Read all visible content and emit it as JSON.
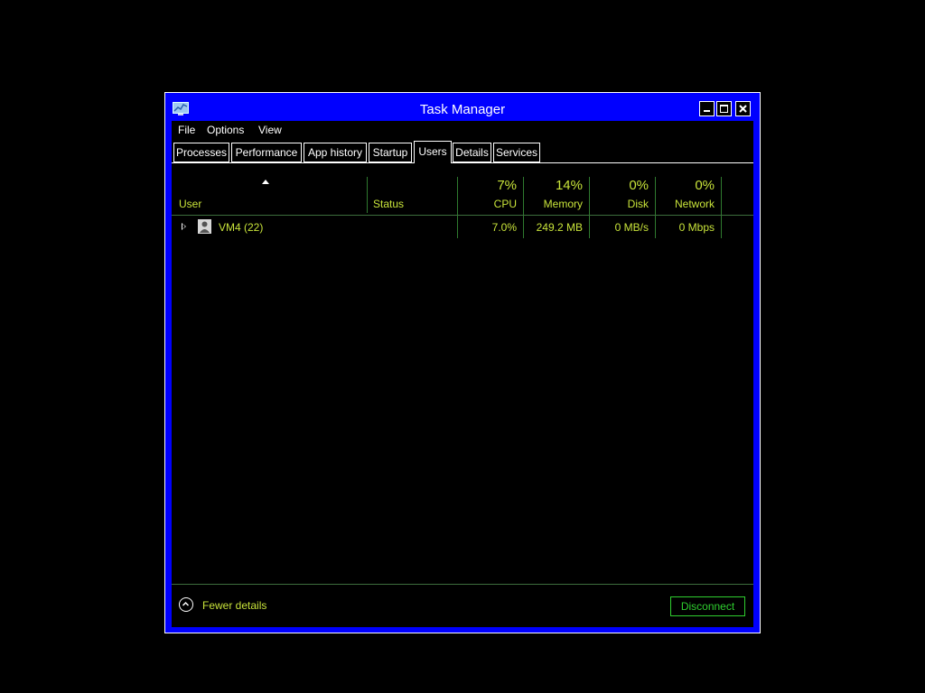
{
  "window": {
    "title": "Task Manager"
  },
  "menu": {
    "file": "File",
    "options": "Options",
    "view": "View"
  },
  "tabs": [
    {
      "label": "Processes"
    },
    {
      "label": "Performance"
    },
    {
      "label": "App history"
    },
    {
      "label": "Startup"
    },
    {
      "label": "Users",
      "active": true
    },
    {
      "label": "Details"
    },
    {
      "label": "Services"
    }
  ],
  "columns": {
    "user": "User",
    "status": "Status",
    "cpu": {
      "label": "CPU",
      "percent": "7%"
    },
    "memory": {
      "label": "Memory",
      "percent": "14%"
    },
    "disk": {
      "label": "Disk",
      "percent": "0%"
    },
    "network": {
      "label": "Network",
      "percent": "0%"
    }
  },
  "rows": [
    {
      "user": "VM4 (22)",
      "status": "",
      "cpu": "7.0%",
      "memory": "249.2 MB",
      "disk": "0 MB/s",
      "network": "0 Mbps"
    }
  ],
  "footer": {
    "fewer_details": "Fewer details",
    "disconnect": "Disconnect"
  },
  "colors": {
    "frame": "#0000ff",
    "text_accent": "#c8e33a",
    "button_accent": "#2fcf2f",
    "background": "#000000"
  }
}
